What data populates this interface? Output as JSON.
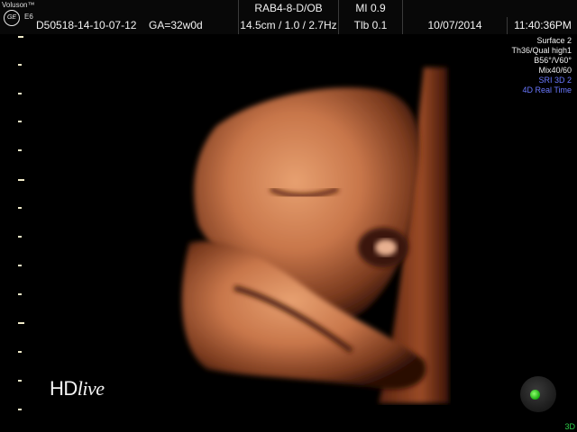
{
  "header": {
    "brand": "Voluson™",
    "logo_text": "GE",
    "model": "E6",
    "probe": "RAB4-8-D/OB",
    "mi": "MI  0.9",
    "patient_id": "D50518-14-10-07-12",
    "ga": "GA=32w0d",
    "depth_freq": "14.5cm / 1.0 / 2.7Hz",
    "tib": "Tlb  0.1",
    "date": "10/07/2014",
    "time": "11:40:36PM"
  },
  "side_panel": {
    "line1": "Surface 2",
    "line2": "Th36/Qual high1",
    "line3": "B56°/V60°",
    "line4": "Mix40/60",
    "line5": "SRI 3D 2",
    "line6": "4D Real Time"
  },
  "overlay": {
    "hd": "HD",
    "live": "live",
    "mode": "3D"
  },
  "colors": {
    "background": "#000000",
    "accent_blue": "#6a78ff",
    "indicator_green": "#2fd04a",
    "tissue": "#c8764a"
  },
  "icons": {
    "logo": "ge-logo-icon",
    "orbit": "rotation-orbit-icon"
  }
}
